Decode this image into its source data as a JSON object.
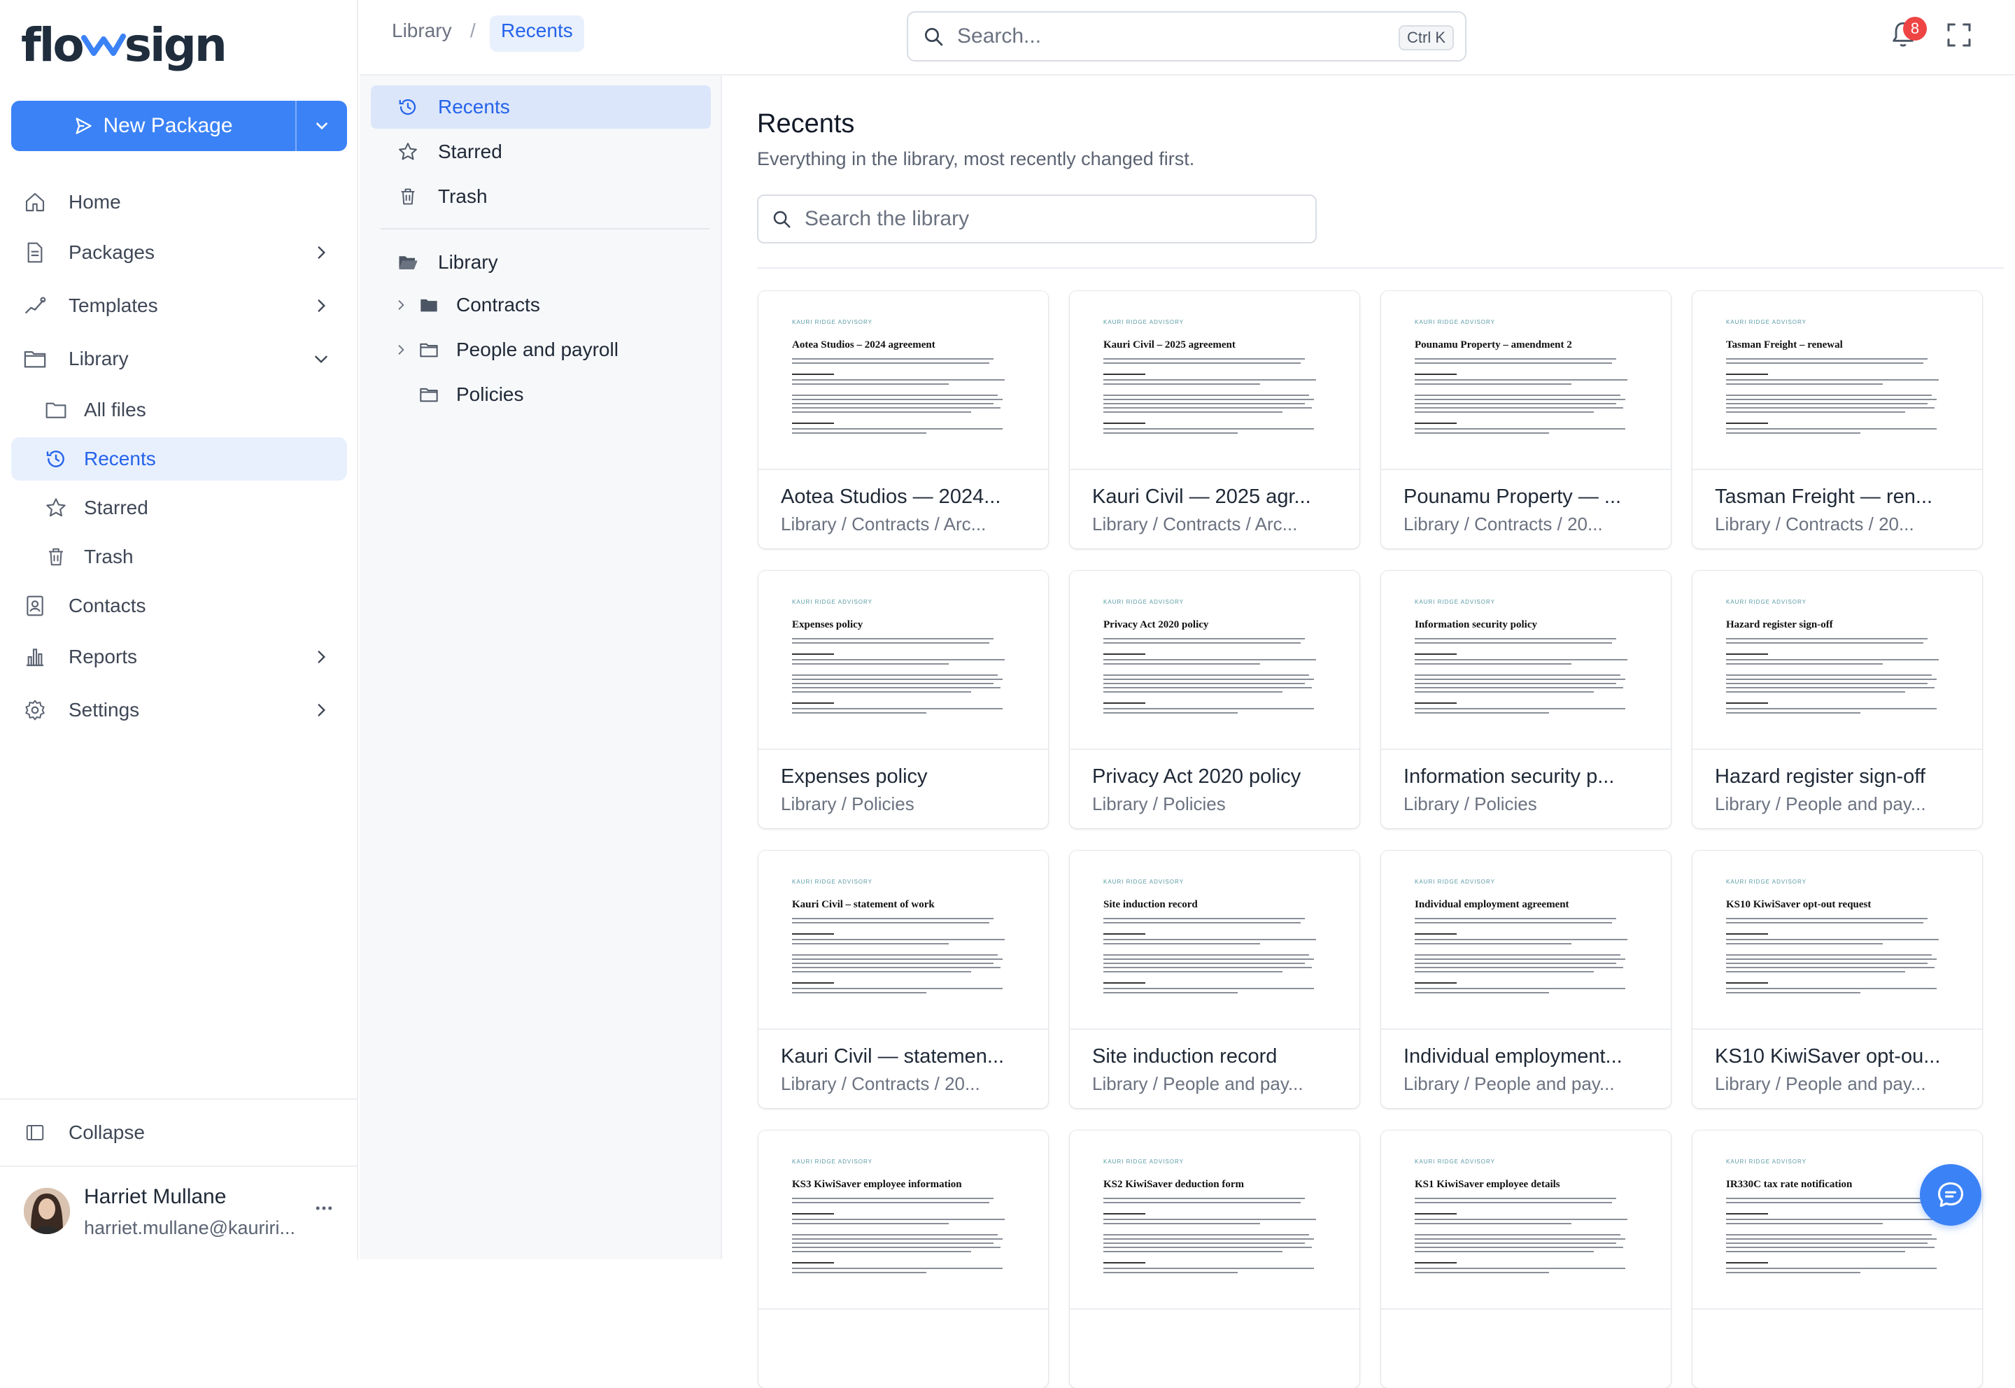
{
  "brand": {
    "logo_left": "flo",
    "logo_right": "sign"
  },
  "sidebar": {
    "new_package": "New Package",
    "items": [
      {
        "label": "Home",
        "icon": "home-icon"
      },
      {
        "label": "Packages",
        "icon": "document-icon"
      },
      {
        "label": "Templates",
        "icon": "templates-icon"
      },
      {
        "label": "Library",
        "icon": "folder-icon"
      },
      {
        "label": "All files",
        "icon": "folder-icon"
      },
      {
        "label": "Recents",
        "icon": "history-icon"
      },
      {
        "label": "Starred",
        "icon": "star-icon"
      },
      {
        "label": "Trash",
        "icon": "trash-icon"
      },
      {
        "label": "Contacts",
        "icon": "contacts-icon"
      },
      {
        "label": "Reports",
        "icon": "reports-icon"
      },
      {
        "label": "Settings",
        "icon": "gear-icon"
      }
    ],
    "collapse": "Collapse",
    "user": {
      "name": "Harriet Mullane",
      "email": "harriet.mullane@kauriri..."
    }
  },
  "topbar": {
    "breadcrumb": [
      "Library",
      "/",
      "Recents"
    ],
    "search_placeholder": "Search...",
    "shortcut": "Ctrl K",
    "notification_count": "8"
  },
  "folders": {
    "quick": [
      "Recents",
      "Starred",
      "Trash"
    ],
    "root": "Library",
    "children": [
      "Contracts",
      "People and payroll",
      "Policies"
    ]
  },
  "main": {
    "title": "Recents",
    "subtitle": "Everything in the library, most recently changed first.",
    "search_placeholder": "Search the library",
    "doc_org": "KAURI RIDGE ADVISORY",
    "cards": [
      {
        "doc_title": "Aotea Studios – 2024 agreement",
        "name": "Aotea Studios — 2024...",
        "path": "Library / Contracts / Arc..."
      },
      {
        "doc_title": "Kauri Civil – 2025 agreement",
        "name": "Kauri Civil — 2025 agr...",
        "path": "Library / Contracts / Arc..."
      },
      {
        "doc_title": "Pounamu Property – amendment 2",
        "name": "Pounamu Property — ...",
        "path": "Library / Contracts / 20..."
      },
      {
        "doc_title": "Tasman Freight – renewal",
        "name": "Tasman Freight — ren...",
        "path": "Library / Contracts / 20..."
      },
      {
        "doc_title": "Expenses policy",
        "name": "Expenses policy",
        "path": "Library / Policies"
      },
      {
        "doc_title": "Privacy Act 2020 policy",
        "name": "Privacy Act 2020 policy",
        "path": "Library / Policies"
      },
      {
        "doc_title": "Information security policy",
        "name": "Information security p...",
        "path": "Library / Policies"
      },
      {
        "doc_title": "Hazard register sign-off",
        "name": "Hazard register sign-off",
        "path": "Library / People and pay..."
      },
      {
        "doc_title": "Kauri Civil – statement of work",
        "name": "Kauri Civil — statemen...",
        "path": "Library / Contracts / 20..."
      },
      {
        "doc_title": "Site induction record",
        "name": "Site induction record",
        "path": "Library / People and pay..."
      },
      {
        "doc_title": "Individual employment agreement",
        "name": "Individual employment...",
        "path": "Library / People and pay..."
      },
      {
        "doc_title": "KS10 KiwiSaver opt-out request",
        "name": "KS10 KiwiSaver opt-ou...",
        "path": "Library / People and pay..."
      },
      {
        "doc_title": "KS3 KiwiSaver employee information",
        "name": "",
        "path": ""
      },
      {
        "doc_title": "KS2 KiwiSaver deduction form",
        "name": "",
        "path": ""
      },
      {
        "doc_title": "KS1 KiwiSaver employee details",
        "name": "",
        "path": ""
      },
      {
        "doc_title": "IR330C tax rate notification",
        "name": "",
        "path": ""
      }
    ]
  },
  "colors": {
    "accent": "#3b82f6",
    "active_bg": "#e8f0fd",
    "badge": "#ef4444"
  }
}
